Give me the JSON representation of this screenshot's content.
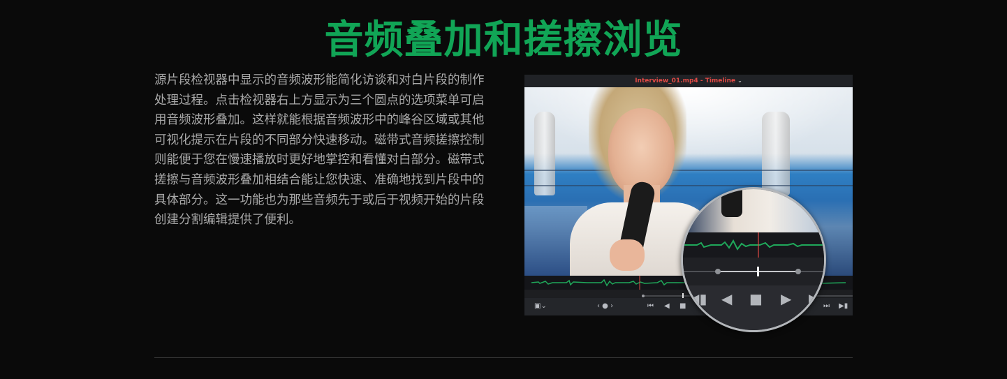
{
  "headline": "音频叠加和搓擦浏览",
  "description": "源片段检视器中显示的音频波形能简化访谈和对白片段的制作处理过程。点击检视器右上方显示为三个圆点的选项菜单可启用音频波形叠加。这样就能根据音频波形中的峰谷区域或其他可视化提示在片段的不同部分快速移动。磁带式音频搓擦控制则能便于您在慢速播放时更好地掌控和看懂对白部分。磁带式搓擦与音频波形叠加相结合能让您快速、准确地找到片段中的具体部分。这一功能也为那些音频先于或后于视频开始的片段创建分割编辑提供了便利。",
  "viewer": {
    "title": "Interview_01.mp4 - Timeline"
  },
  "colors": {
    "headline": "#11a556",
    "waveform": "#1fa85a",
    "playhead": "#e04a45",
    "text": "#a9a9a9",
    "background": "#0a0a0a"
  },
  "icons": {
    "viewer_mode": "viewer-mode-icon",
    "jog": "jog-wheel-icon",
    "skip_back": "skip-to-start-icon",
    "play_reverse": "play-reverse-icon",
    "stop": "stop-icon",
    "play": "play-icon",
    "skip_end": "skip-to-end-icon",
    "next": "next-clip-icon"
  }
}
